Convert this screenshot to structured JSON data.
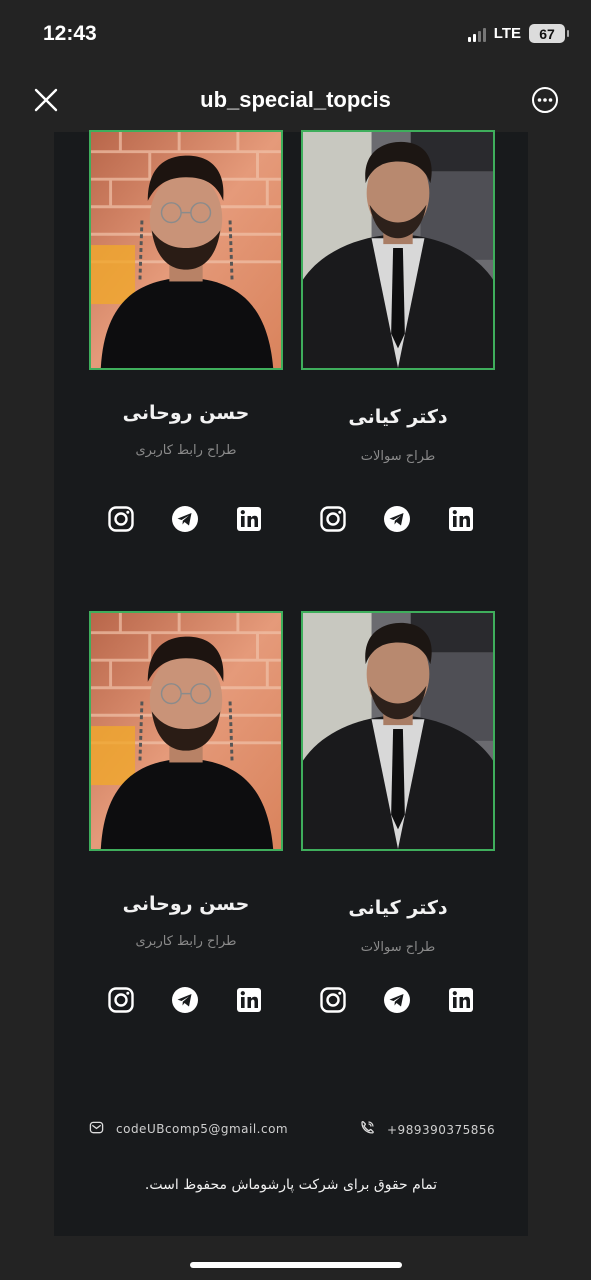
{
  "status_bar": {
    "time": "12:43",
    "network": "LTE",
    "battery": "67"
  },
  "nav": {
    "title": "ub_special_topcis",
    "close_icon": "close-icon",
    "more_icon": "more-icon"
  },
  "team": [
    {
      "name": "حسن روحانی",
      "role": "طراح رابط کاربری",
      "socials": [
        "instagram-icon",
        "telegram-icon",
        "linkedin-icon"
      ]
    },
    {
      "name": "دکتر کیانی",
      "role": "طراح سوالات",
      "socials": [
        "instagram-icon",
        "telegram-icon",
        "linkedin-icon"
      ]
    },
    {
      "name": "حسن روحانی",
      "role": "طراح رابط کاربری",
      "socials": [
        "instagram-icon",
        "telegram-icon",
        "linkedin-icon"
      ]
    },
    {
      "name": "دکتر کیانی",
      "role": "طراح سوالات",
      "socials": [
        "instagram-icon",
        "telegram-icon",
        "linkedin-icon"
      ]
    }
  ],
  "footer": {
    "email": "codeUBcomp5@gmail.com",
    "phone": "+989390375856",
    "copyright": "تمام حقوق برای شرکت پارشوماش محفوظ است."
  },
  "colors": {
    "accent_border": "#3fae5c",
    "panel_bg": "#181a1c",
    "page_bg": "#232323"
  }
}
